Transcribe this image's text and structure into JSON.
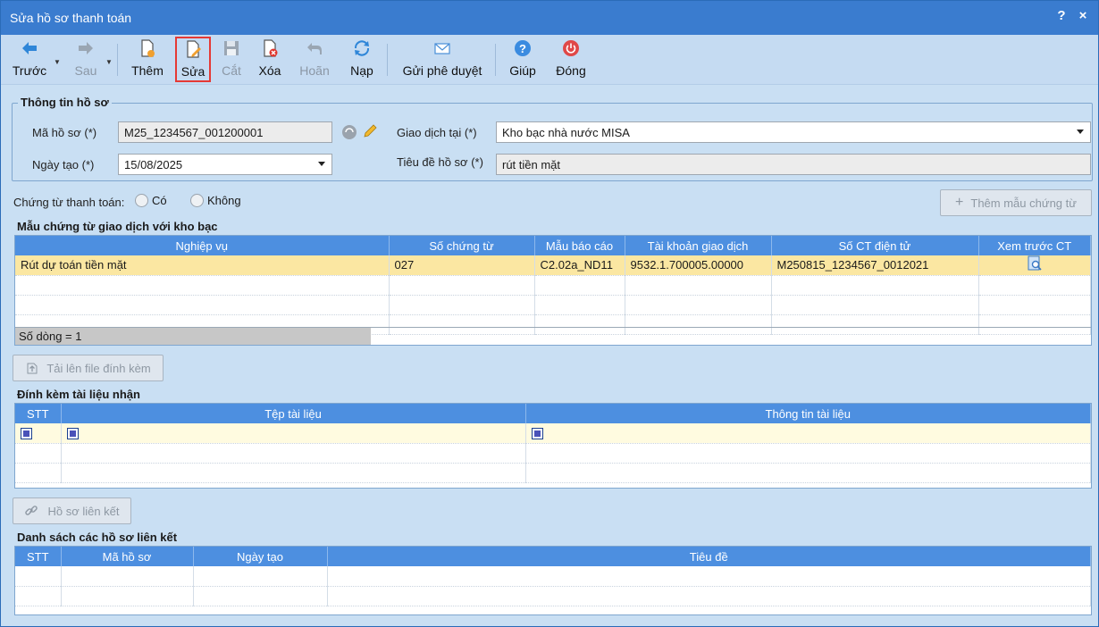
{
  "window": {
    "title": "Sửa hồ sơ thanh toán",
    "help": "?",
    "close": "×"
  },
  "toolbar": {
    "prev": "Trước",
    "next": "Sau",
    "add": "Thêm",
    "edit": "Sửa",
    "cut": "Cắt",
    "delete": "Xóa",
    "undo": "Hoãn",
    "reload": "Nạp",
    "send": "Gửi phê duyệt",
    "help": "Giúp",
    "close": "Đóng"
  },
  "info": {
    "legend": "Thông tin hồ sơ",
    "code_label": "Mã hồ sơ (*)",
    "code_value": "M25_1234567_001200001",
    "date_label": "Ngày tạo (*)",
    "date_value": "15/08/2025",
    "place_label": "Giao dịch tại (*)",
    "place_value": "Kho bạc nhà nước MISA",
    "title_label": "Tiêu đề hồ sơ (*)",
    "title_value": "rút tiền mặt"
  },
  "voucher": {
    "label": "Chứng từ thanh toán:",
    "yes": "Có",
    "no": "Không",
    "add_template": "Thêm mẫu chứng từ"
  },
  "templates": {
    "legend": "Mẫu chứng từ giao dịch với kho bạc",
    "columns": [
      "Nghiệp vụ",
      "Số chứng từ",
      "Mẫu báo cáo",
      "Tài khoản giao dịch",
      "Số CT điện tử",
      "Xem trước CT"
    ],
    "row": {
      "operation": "Rút dự toán tiền mặt",
      "number": "027",
      "form": "C2.02a_ND11",
      "account": "9532.1.700005.00000",
      "ecode": "M250815_1234567_0012021"
    },
    "count": "Số dòng = 1"
  },
  "upload_button": "Tải lên file đính kèm",
  "attachments": {
    "legend": "Đính kèm tài liệu nhận",
    "columns": [
      "STT",
      "Tệp tài liệu",
      "Thông tin tài liệu"
    ]
  },
  "link_button": "Hồ sơ liên kết",
  "linked": {
    "legend": "Danh sách các hồ sơ liên kết",
    "columns": [
      "STT",
      "Mã hồ sơ",
      "Ngày tạo",
      "Tiêu đề"
    ]
  }
}
